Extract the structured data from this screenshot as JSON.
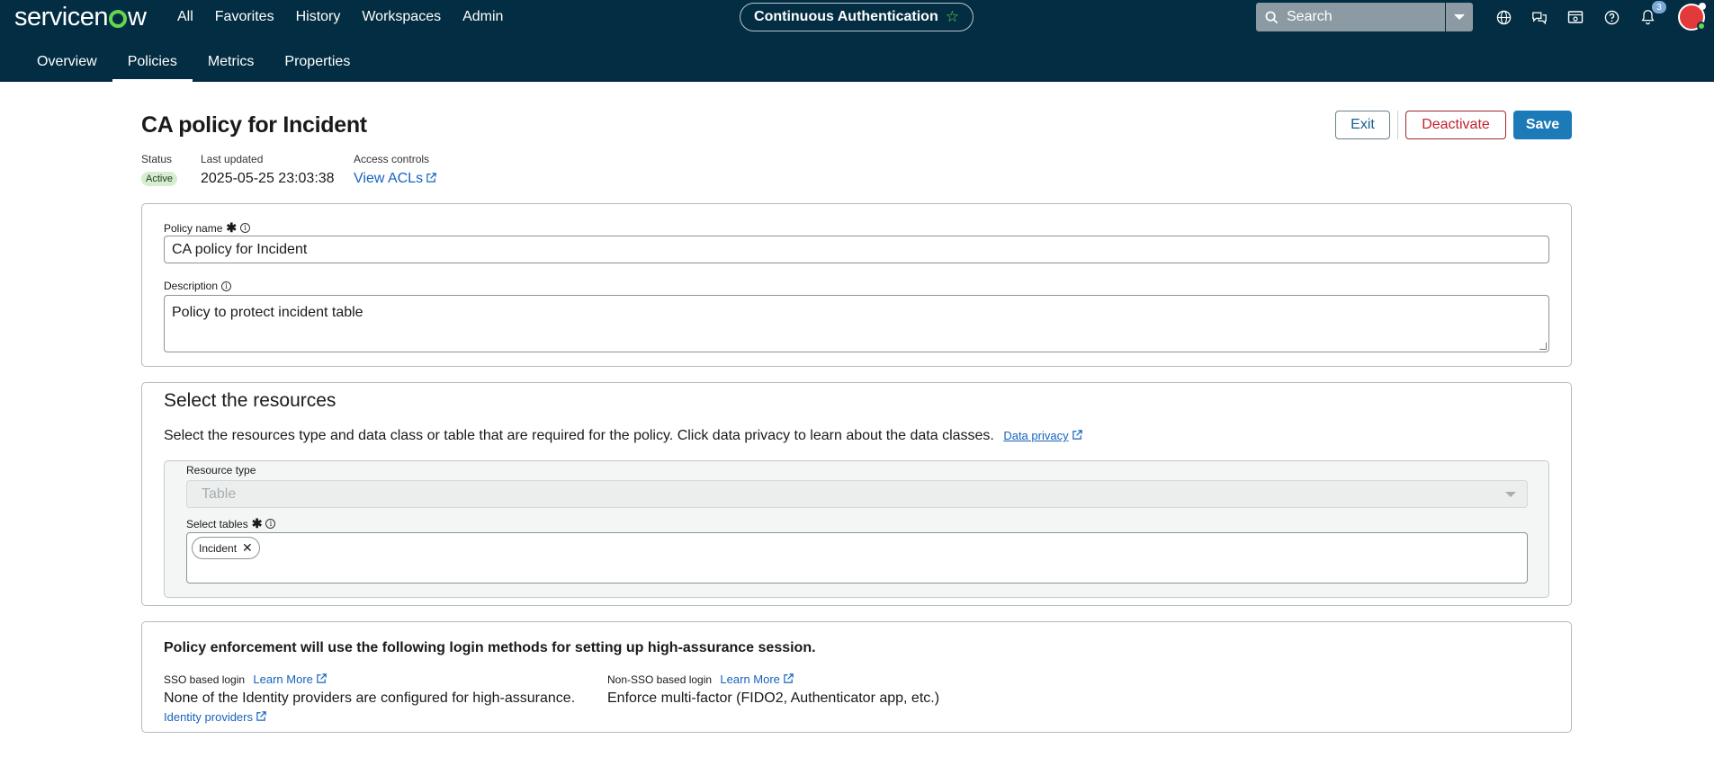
{
  "app": {
    "logo_text": "servicenow",
    "primary_nav": [
      "All",
      "Favorites",
      "History",
      "Workspaces",
      "Admin"
    ],
    "context_pill": "Continuous Authentication",
    "search_placeholder": "Search",
    "notification_count": "3",
    "avatar_initials": "",
    "secondary_tabs": [
      "Overview",
      "Policies",
      "Metrics",
      "Properties"
    ],
    "active_tab": "Policies"
  },
  "header": {
    "title": "CA policy for Incident",
    "buttons": {
      "exit": "Exit",
      "deactivate": "Deactivate",
      "save": "Save"
    },
    "status_label": "Status",
    "status_value": "Active",
    "updated_label": "Last updated",
    "updated_value": "2025-05-25 23:03:38",
    "access_label": "Access controls",
    "access_link": "View ACLs"
  },
  "policy_form": {
    "name_label": "Policy name",
    "name_value": "CA policy for Incident",
    "description_label": "Description",
    "description_value": "Policy to protect incident table"
  },
  "resources": {
    "title": "Select the resources",
    "description": "Select the resources type and data class or table that are required for the policy. Click data privacy to learn about the data classes.",
    "privacy_link": "Data privacy",
    "resource_type_label": "Resource type",
    "resource_type_value": "Table",
    "tables_label": "Select tables",
    "selected_tables": [
      "Incident"
    ]
  },
  "enforcement": {
    "title": "Policy enforcement will use the following login methods for setting up high-assurance session.",
    "sso_label": "SSO based login",
    "sso_link": "Learn More",
    "sso_value": "None of the Identity providers are configured for high-assurance.",
    "sso_sub_link": "Identity providers",
    "nonsso_label": "Non-SSO based login",
    "nonsso_link": "Learn More",
    "nonsso_value": "Enforce multi-factor (FIDO2, Authenticator app, etc.)"
  },
  "colors": {
    "topbar": "#032d42",
    "brand_green": "#62d84e",
    "primary_button": "#1c7ab8",
    "danger": "#c0222e",
    "link": "#1762bd"
  }
}
